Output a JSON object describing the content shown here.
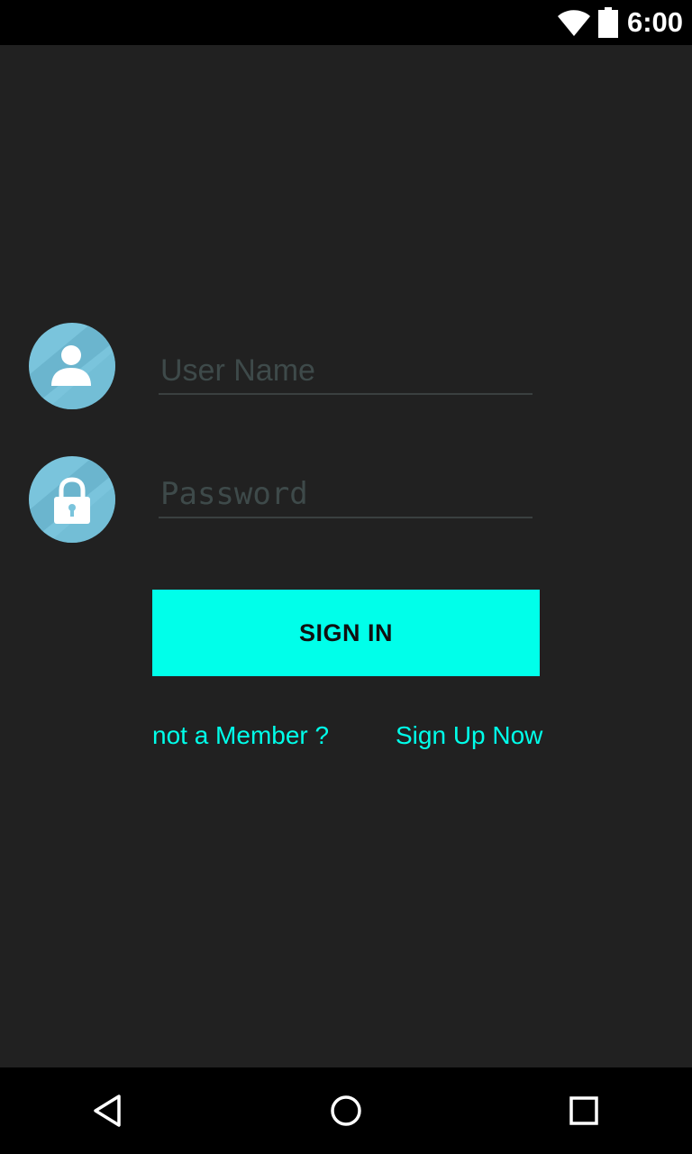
{
  "status_bar": {
    "time": "6:00",
    "icons": [
      "wifi-icon",
      "battery-icon"
    ]
  },
  "form": {
    "username": {
      "icon": "user-icon",
      "placeholder": "User Name",
      "value": ""
    },
    "password": {
      "icon": "lock-icon",
      "placeholder": "Password",
      "value": ""
    },
    "signin_label": "SIGN IN",
    "member_prompt": "not a Member ?",
    "signup_link": "Sign Up Now"
  },
  "colors": {
    "background": "#212121",
    "accent": "#00ffea",
    "icon_circle": "#7ac4dc",
    "bars": "#000000"
  },
  "nav_bar": {
    "buttons": [
      "back-icon",
      "home-icon",
      "recents-icon"
    ]
  }
}
